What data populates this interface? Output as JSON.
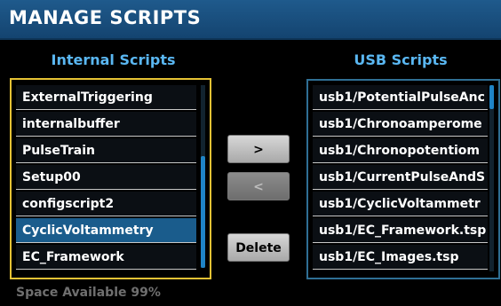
{
  "title": "MANAGE SCRIPTS",
  "internal": {
    "header": "Internal Scripts",
    "items": [
      "ExternalTriggering",
      "internalbuffer",
      "PulseTrain",
      "Setup00",
      "configscript2",
      "CyclicVoltammetry",
      "EC_Framework"
    ],
    "selected_index": 5
  },
  "usb": {
    "header": "USB Scripts",
    "items": [
      "usb1/PotentialPulseAnc",
      "usb1/Chronoamperome",
      "usb1/Chronopotentiom",
      "usb1/CurrentPulseAndS",
      "usb1/CyclicVoltammetr",
      "usb1/EC_Framework.tsp",
      "usb1/EC_Images.tsp"
    ]
  },
  "buttons": {
    "copy_to_usb": ">",
    "copy_to_internal": "<",
    "delete": "Delete"
  },
  "status": {
    "space_available": "Space Available 99%"
  },
  "colors": {
    "title_bar": "#1a4e7e",
    "header_text": "#5ab7f2",
    "internal_focus_border": "#e5c234",
    "selected_row": "#1a5c8c",
    "scrollbar": "#1f84c6"
  }
}
